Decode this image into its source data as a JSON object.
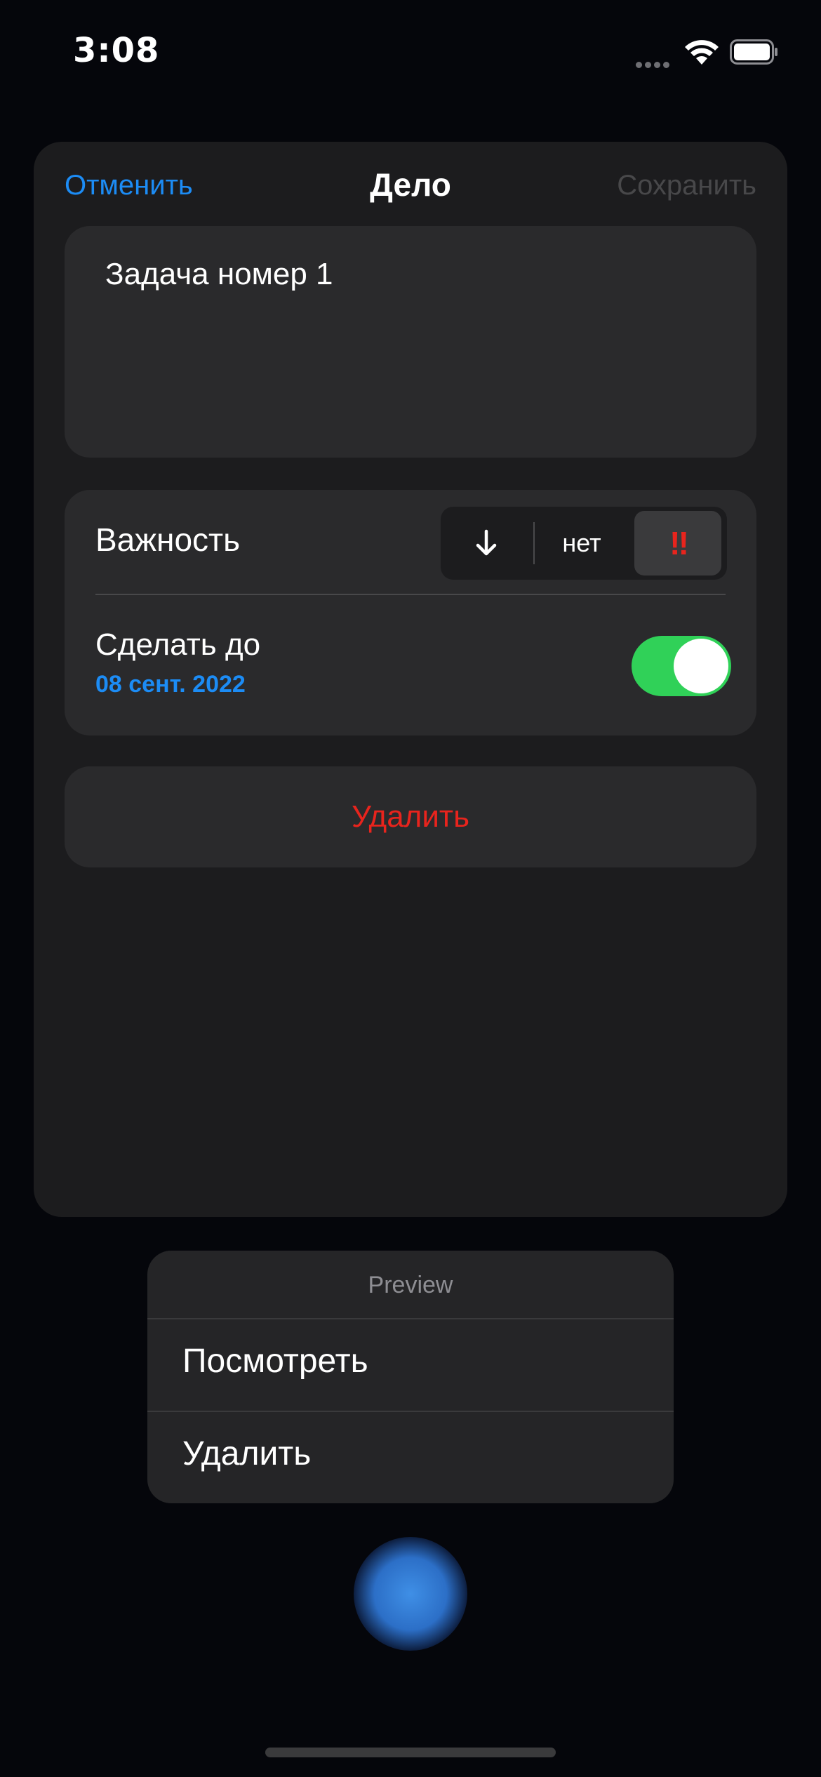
{
  "status_bar": {
    "time": "3:08",
    "wifi_icon": "wifi-icon",
    "battery_icon": "battery-icon"
  },
  "sheet": {
    "nav": {
      "cancel_label": "Отменить",
      "title": "Дело",
      "save_label": "Сохранить"
    },
    "task_text": "Задача номер 1",
    "importance": {
      "label": "Важность",
      "options": {
        "low_icon": "arrow-down-icon",
        "none": "нет",
        "high": "‼"
      },
      "selected": "high"
    },
    "deadline": {
      "label": "Сделать до",
      "date": "08 сент. 2022",
      "enabled": true
    },
    "delete_label": "Удалить"
  },
  "context_menu": {
    "header": "Preview",
    "items": [
      {
        "label": "Посмотреть"
      },
      {
        "label": "Удалить"
      }
    ]
  },
  "colors": {
    "accent_blue": "#1c8cf5",
    "destructive_red": "#e8241d",
    "toggle_green": "#30d158",
    "disabled_gray": "#48484a"
  }
}
